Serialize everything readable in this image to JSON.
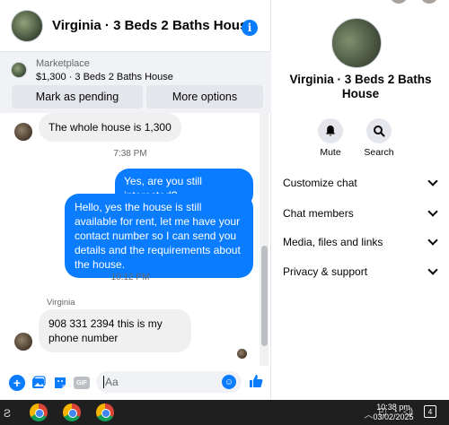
{
  "chat": {
    "title": "Virginia · 3 Beds 2 Baths House",
    "info_icon": "i"
  },
  "marketplace": {
    "label": "Marketplace",
    "listing": "$1,300 · 3 Beds 2 Baths House",
    "mark_pending": "Mark as pending",
    "more_options": "More options"
  },
  "messages": [
    {
      "direction": "in",
      "text": "The whole house is 1,300"
    },
    {
      "type": "time",
      "text": "7:38 PM"
    },
    {
      "direction": "out",
      "text": "Yes, are you still interested?"
    },
    {
      "direction": "out",
      "text": "Hello, yes the house is still available for rent, let me have your contact number so I can send you details and the requirements about the house."
    },
    {
      "type": "time",
      "text": "10:12 PM"
    },
    {
      "direction": "in",
      "sender": "Virginia",
      "text": "908 331 2394 this is my phone number"
    }
  ],
  "composer": {
    "placeholder": "Aa",
    "icons": [
      "plus-icon",
      "photo-icon",
      "sticker-icon",
      "gif-icon",
      "emoji-icon",
      "thumbs-up-icon"
    ],
    "gif_label": "GIF"
  },
  "profile": {
    "name": "Virginia · 3 Beds 2 Baths House",
    "mute_label": "Mute",
    "search_label": "Search"
  },
  "sections": [
    "Customize chat",
    "Chat members",
    "Media, files and links",
    "Privacy & support"
  ],
  "taskbar": {
    "time": "10:38 pm",
    "date": "03/02/2025",
    "notification_count": "4"
  },
  "colors": {
    "accent": "#0a7cff",
    "bubble_in": "#f0f0f0",
    "card_bg": "#f0f2f5"
  }
}
